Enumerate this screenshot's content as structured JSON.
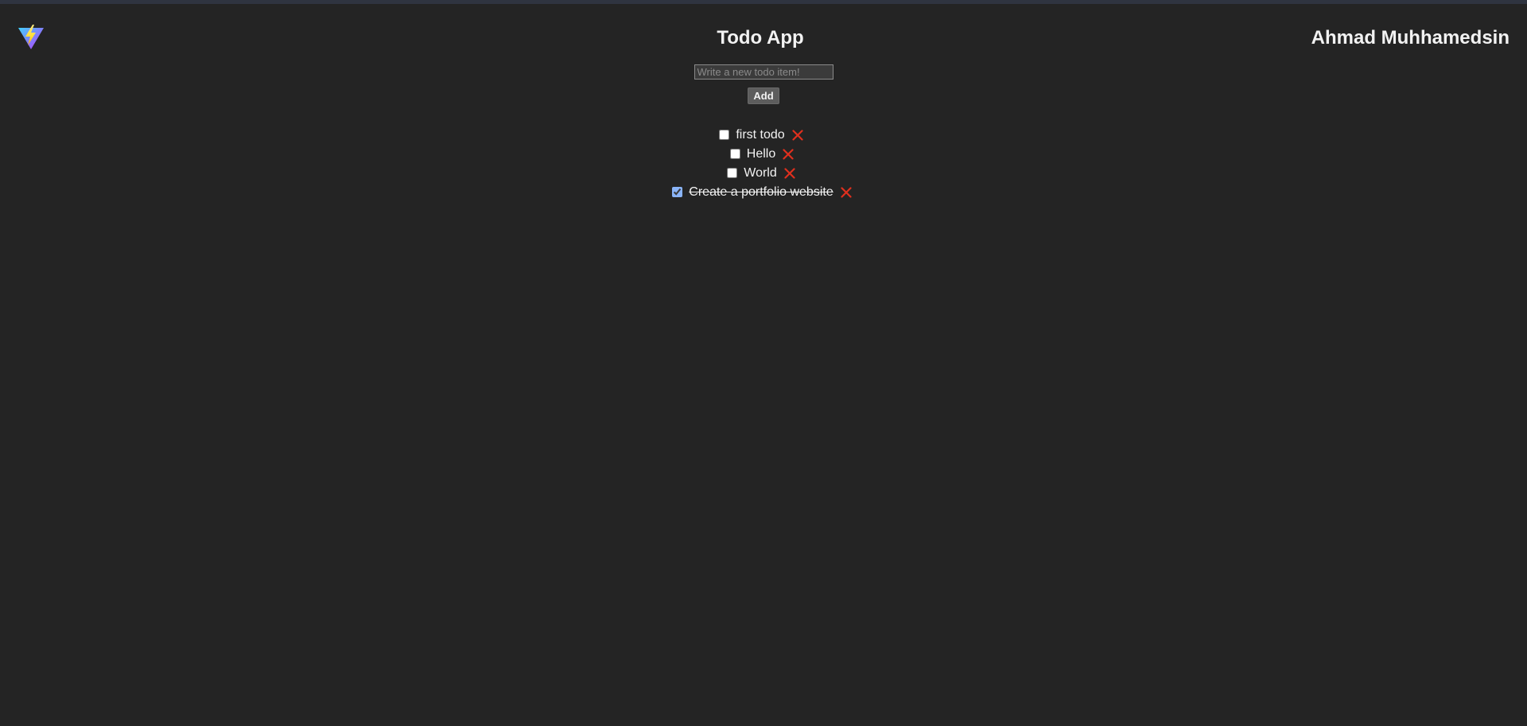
{
  "header": {
    "title": "Todo App",
    "author": "Ahmad Muhhamedsin",
    "logo_icon": "vite-logo-icon"
  },
  "form": {
    "placeholder": "Write a new todo item!",
    "value": "",
    "add_label": "Add"
  },
  "todos": [
    {
      "text": "first todo",
      "done": false
    },
    {
      "text": "Hello",
      "done": false
    },
    {
      "text": "World",
      "done": false
    },
    {
      "text": "Create a portfolio website",
      "done": true
    }
  ],
  "colors": {
    "background": "#242424",
    "delete_icon": "#e0301e",
    "checkbox_accent": "#8ab4f8"
  }
}
